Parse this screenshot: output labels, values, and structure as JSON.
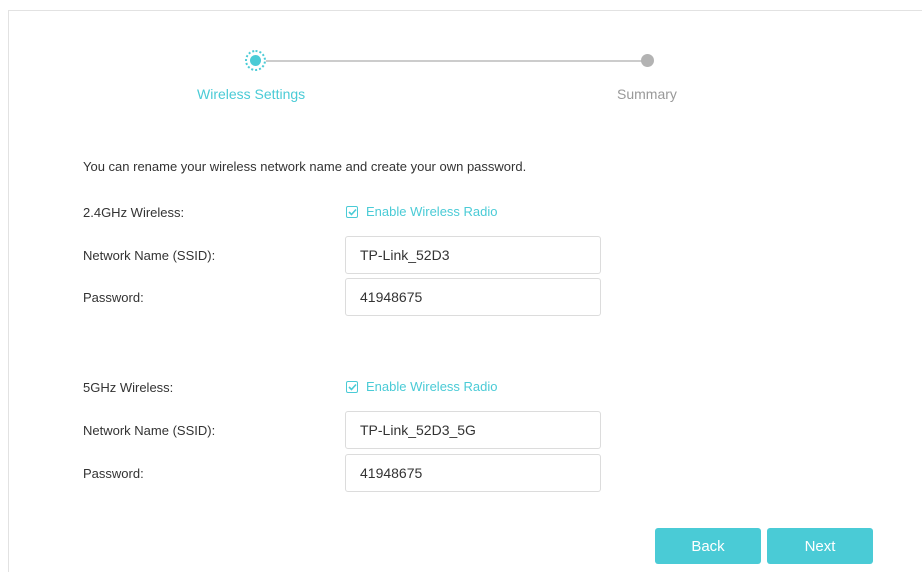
{
  "stepper": {
    "steps": [
      {
        "label": "Wireless Settings",
        "state": "active"
      },
      {
        "label": "Summary",
        "state": "pending"
      }
    ]
  },
  "intro_text": "You can rename your wireless network name and create your own password.",
  "band_24": {
    "label": "2.4GHz Wireless:",
    "enable_label": "Enable Wireless Radio",
    "enabled": true,
    "ssid_label": "Network Name (SSID):",
    "ssid_value": "TP-Link_52D3",
    "password_label": "Password:",
    "password_value": "41948675"
  },
  "band_5": {
    "label": "5GHz Wireless:",
    "enable_label": "Enable Wireless Radio",
    "enabled": true,
    "ssid_label": "Network Name (SSID):",
    "ssid_value": "TP-Link_52D3_5G",
    "password_label": "Password:",
    "password_value": "41948675"
  },
  "buttons": {
    "back_label": "Back",
    "next_label": "Next"
  },
  "colors": {
    "accent": "#4acbd6",
    "inactive_step": "#b3b3b3",
    "text": "#333333"
  },
  "icons": {
    "checkbox_checked": "check-icon"
  }
}
